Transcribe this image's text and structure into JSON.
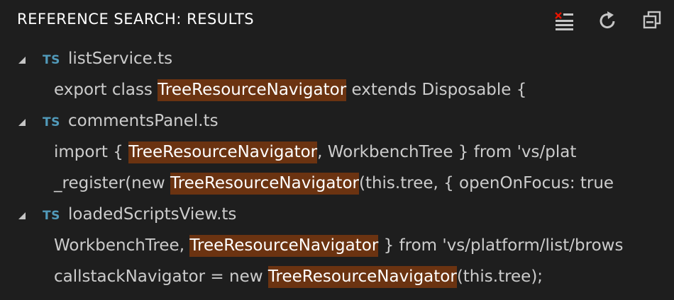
{
  "header": {
    "title": "REFERENCE SEARCH: RESULTS",
    "actions": [
      {
        "name": "clear-results",
        "icon": "clear-all-icon"
      },
      {
        "name": "refresh",
        "icon": "refresh-icon"
      },
      {
        "name": "collapse-all",
        "icon": "collapse-all-icon"
      }
    ]
  },
  "colors": {
    "background": "#1e1e1e",
    "text": "#cccccc",
    "highlight": "#6b3311",
    "ts_icon": "#519aba",
    "clear_icon_accent": "#e51400"
  },
  "results": [
    {
      "file": "listService.ts",
      "icon_label": "TS",
      "expanded": true,
      "matches": [
        {
          "before": "export class ",
          "match": "TreeResourceNavigator",
          "after": " extends Disposable {"
        }
      ]
    },
    {
      "file": "commentsPanel.ts",
      "icon_label": "TS",
      "expanded": true,
      "matches": [
        {
          "before": "import { ",
          "match": "TreeResourceNavigator",
          "after": ", WorkbenchTree } from 'vs/plat"
        },
        {
          "before": "_register(new ",
          "match": "TreeResourceNavigator",
          "after": "(this.tree, { openOnFocus: true"
        }
      ]
    },
    {
      "file": "loadedScriptsView.ts",
      "icon_label": "TS",
      "expanded": true,
      "matches": [
        {
          "before": "WorkbenchTree, ",
          "match": "TreeResourceNavigator",
          "after": " } from 'vs/platform/list/brows"
        },
        {
          "before": "callstackNavigator = new ",
          "match": "TreeResourceNavigator",
          "after": "(this.tree);"
        }
      ]
    }
  ]
}
